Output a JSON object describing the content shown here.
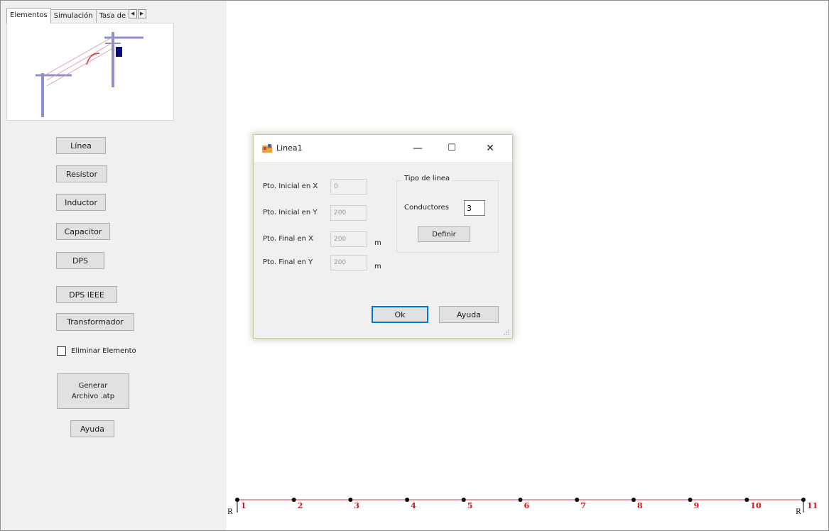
{
  "tabs": [
    {
      "label": "Elementos",
      "active": true
    },
    {
      "label": "Simulación",
      "active": false
    },
    {
      "label": "Tasa de fallas",
      "active": false
    }
  ],
  "tab_scroll": {
    "left_icon": "arrow-left-icon",
    "right_icon": "arrow-right-icon"
  },
  "sidebar": {
    "buttons": [
      {
        "label": "Línea"
      },
      {
        "label": "Resistor"
      },
      {
        "label": "Inductor"
      },
      {
        "label": "Capacitor"
      },
      {
        "label": "DPS"
      },
      {
        "label": "DPS IEEE"
      },
      {
        "label": "Transformador"
      }
    ],
    "delete_checkbox": {
      "label": "Eliminar Elemento",
      "checked": false
    },
    "generate_button": "Generar\nArchivo .atp",
    "help_button": "Ayuda"
  },
  "dialog": {
    "title": "Linea1",
    "minimize_glyph": "—",
    "maximize_glyph": "☐",
    "close_glyph": "✕",
    "fields": [
      {
        "label": "Pto. Inicial en X",
        "value": "0",
        "unit": ""
      },
      {
        "label": "Pto. Inicial en Y",
        "value": "200",
        "unit": ""
      },
      {
        "label": "Pto. Final en X",
        "value": "200",
        "unit": "m"
      },
      {
        "label": "Pto. Final en Y",
        "value": "200",
        "unit": "m"
      }
    ],
    "group_title": "Tipo de linea",
    "conductors_label": "Conductores",
    "conductors_value": "3",
    "define_button": "Definir",
    "ok_button": "Ok",
    "help_button": "Ayuda"
  },
  "line_nodes": {
    "labels": [
      "1",
      "2",
      "3",
      "4",
      "5",
      "6",
      "7",
      "8",
      "9",
      "10",
      "11"
    ],
    "end_marker": "R",
    "color": "#d21818",
    "line_color": "#e87c86"
  },
  "colors": {
    "pole": "#8f8fd0",
    "transformer": "#0a0a7a",
    "accent": "#0078d7"
  }
}
